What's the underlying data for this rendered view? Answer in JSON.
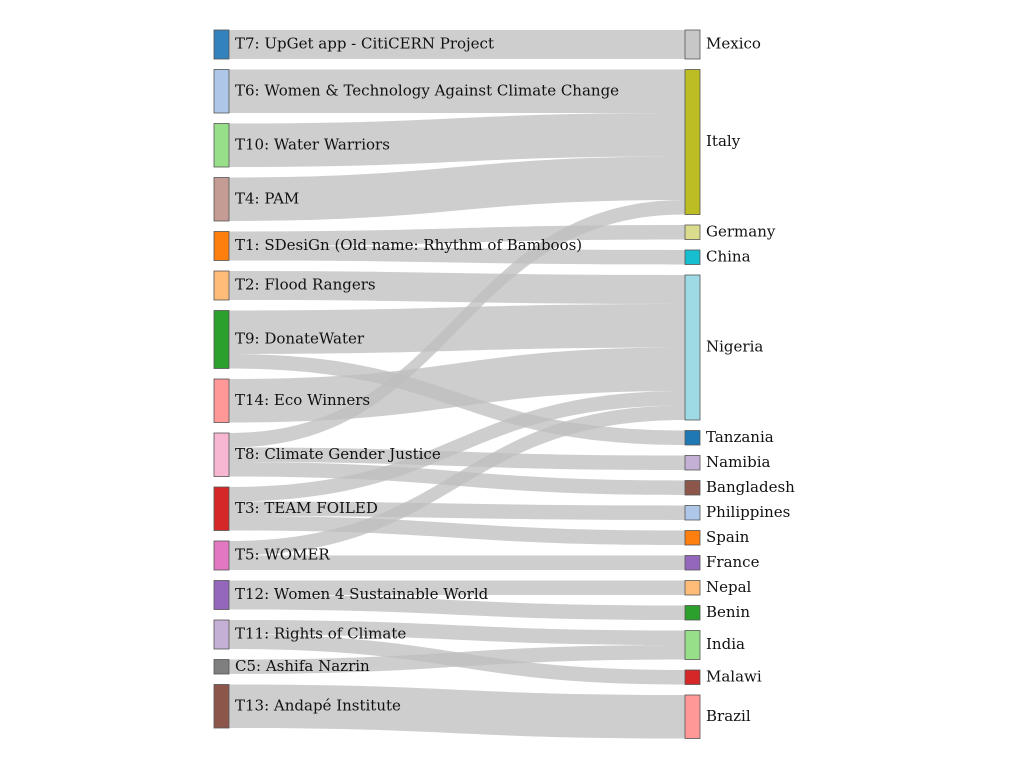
{
  "chart_data": {
    "type": "sankey",
    "sources": [
      {
        "label": "T7: UpGet app - CitiCERN Project",
        "color": "#3182bd",
        "value": 1
      },
      {
        "label": "T6: Women & Technology Against Climate Change",
        "color": "#aec7e8",
        "value": 1.5
      },
      {
        "label": "T10: Water Warriors",
        "color": "#98df8a",
        "value": 1.5
      },
      {
        "label": "T4: PAM",
        "color": "#c49c94",
        "value": 1.5
      },
      {
        "label": "T1: SDesiGn (Old name: Rhythm of Bamboos)",
        "color": "#ff7f0e",
        "value": 1
      },
      {
        "label": "T2: Flood Rangers",
        "color": "#ffbb78",
        "value": 1
      },
      {
        "label": "T9: DonateWater",
        "color": "#2ca02c",
        "value": 2
      },
      {
        "label": "T14: Eco Winners",
        "color": "#ff9896",
        "value": 1.5
      },
      {
        "label": "T8: Climate Gender Justice",
        "color": "#f7b6d2",
        "value": 1.5
      },
      {
        "label": "T3: TEAM FOILED",
        "color": "#d62728",
        "value": 1.5
      },
      {
        "label": "T5: WOMER",
        "color": "#e377c2",
        "value": 1
      },
      {
        "label": "T12: Women 4 Sustainable World",
        "color": "#9467bd",
        "value": 1
      },
      {
        "label": "T11: Rights of Climate",
        "color": "#c5b0d5",
        "value": 1
      },
      {
        "label": "C5: Ashifa Nazrin",
        "color": "#7f7f7f",
        "value": 0.5
      },
      {
        "label": "T13: Andapé Institute",
        "color": "#8c564b",
        "value": 1.5
      }
    ],
    "targets": [
      {
        "label": "Mexico",
        "color": "#c7c7c7",
        "value": 1
      },
      {
        "label": "Italy",
        "color": "#bcbd22",
        "value": 5
      },
      {
        "label": "Germany",
        "color": "#dbdb8d",
        "value": 0.5
      },
      {
        "label": "China",
        "color": "#17becf",
        "value": 0.5
      },
      {
        "label": "Nigeria",
        "color": "#9edae5",
        "value": 5
      },
      {
        "label": "Tanzania",
        "color": "#1f77b4",
        "value": 0.5
      },
      {
        "label": "Namibia",
        "color": "#c5b0d5",
        "value": 0.5
      },
      {
        "label": "Bangladesh",
        "color": "#8c564b",
        "value": 0.5
      },
      {
        "label": "Philippines",
        "color": "#aec7e8",
        "value": 0.5
      },
      {
        "label": "Spain",
        "color": "#ff7f0e",
        "value": 0.5
      },
      {
        "label": "France",
        "color": "#9467bd",
        "value": 0.5
      },
      {
        "label": "Nepal",
        "color": "#ffbb78",
        "value": 0.5
      },
      {
        "label": "Benin",
        "color": "#2ca02c",
        "value": 0.5
      },
      {
        "label": "India",
        "color": "#98df8a",
        "value": 1
      },
      {
        "label": "Malawi",
        "color": "#d62728",
        "value": 0.5
      },
      {
        "label": "Brazil",
        "color": "#ff9896",
        "value": 1.5
      }
    ],
    "links": [
      {
        "source": 0,
        "target": 0,
        "value": 1
      },
      {
        "source": 1,
        "target": 1,
        "value": 1.5
      },
      {
        "source": 2,
        "target": 1,
        "value": 1.5
      },
      {
        "source": 3,
        "target": 1,
        "value": 1.5
      },
      {
        "source": 4,
        "target": 2,
        "value": 0.5
      },
      {
        "source": 4,
        "target": 3,
        "value": 0.5
      },
      {
        "source": 5,
        "target": 4,
        "value": 1
      },
      {
        "source": 6,
        "target": 4,
        "value": 1.5
      },
      {
        "source": 6,
        "target": 5,
        "value": 0.5
      },
      {
        "source": 7,
        "target": 4,
        "value": 1.5
      },
      {
        "source": 8,
        "target": 1,
        "value": 0.5
      },
      {
        "source": 8,
        "target": 6,
        "value": 0.5
      },
      {
        "source": 8,
        "target": 7,
        "value": 0.5
      },
      {
        "source": 9,
        "target": 4,
        "value": 0.5
      },
      {
        "source": 9,
        "target": 8,
        "value": 0.5
      },
      {
        "source": 9,
        "target": 9,
        "value": 0.5
      },
      {
        "source": 10,
        "target": 4,
        "value": 0.5
      },
      {
        "source": 10,
        "target": 10,
        "value": 0.5
      },
      {
        "source": 11,
        "target": 11,
        "value": 0.5
      },
      {
        "source": 11,
        "target": 12,
        "value": 0.5
      },
      {
        "source": 12,
        "target": 13,
        "value": 0.5
      },
      {
        "source": 12,
        "target": 14,
        "value": 0.5
      },
      {
        "source": 13,
        "target": 13,
        "value": 0.5
      },
      {
        "source": 14,
        "target": 15,
        "value": 1.5
      }
    ]
  }
}
